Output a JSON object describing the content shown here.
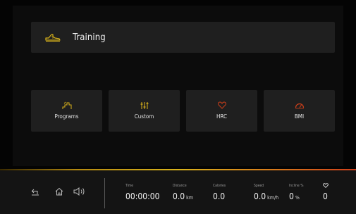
{
  "colors": {
    "accent_yellow": "#d8b21b",
    "accent_orange": "#cf3f1a",
    "tile_background": "#1f1f1f",
    "background": "#040404"
  },
  "header": {
    "icon": "running-shoe-icon",
    "title": "Training"
  },
  "tiles": [
    {
      "label": "Programs",
      "icon": "stairs-icon"
    },
    {
      "label": "Custom",
      "icon": "sliders-icon"
    },
    {
      "label": "HRC",
      "icon": "heart-icon"
    },
    {
      "label": "BMI",
      "icon": "gauge-icon"
    }
  ],
  "bottom_bar": {
    "icons": [
      "back-icon",
      "home-icon",
      "volume-icon"
    ],
    "metrics": {
      "time": {
        "label": "Time",
        "value": "00:00:00",
        "unit": ""
      },
      "distance": {
        "label": "Distance",
        "value": "0.0",
        "unit": "km"
      },
      "calories": {
        "label": "Calories",
        "value": "0.0",
        "unit": ""
      },
      "speed": {
        "label": "Speed",
        "value": "0.0",
        "unit": "km/h"
      },
      "incline": {
        "label": "Incline %",
        "value": "0",
        "unit": "%"
      },
      "heart_rate": {
        "label": "",
        "icon": "heart-icon",
        "value": "0",
        "unit": ""
      }
    }
  }
}
